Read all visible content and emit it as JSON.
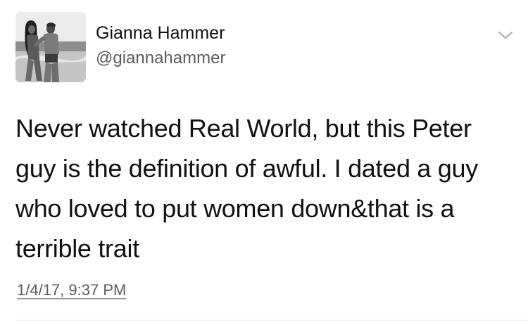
{
  "tweet": {
    "author": {
      "display_name": "Gianna Hammer",
      "handle": "@giannahammer",
      "avatar": "profile-photo"
    },
    "menu_icon": "chevron-down-icon",
    "text_lines": [
      "Never watched Real World, but this Peter",
      "guy is the definition of awful. I dated a guy",
      "who loved to put women down&that is a",
      "terrible trait"
    ],
    "timestamp": "1/4/17, 9:37 PM"
  },
  "colors": {
    "background": "#ffffff",
    "text": "#111111",
    "secondary_text": "#5b5b5b",
    "chevron": "#b5b5b5",
    "divider": "#e3e3e3"
  }
}
